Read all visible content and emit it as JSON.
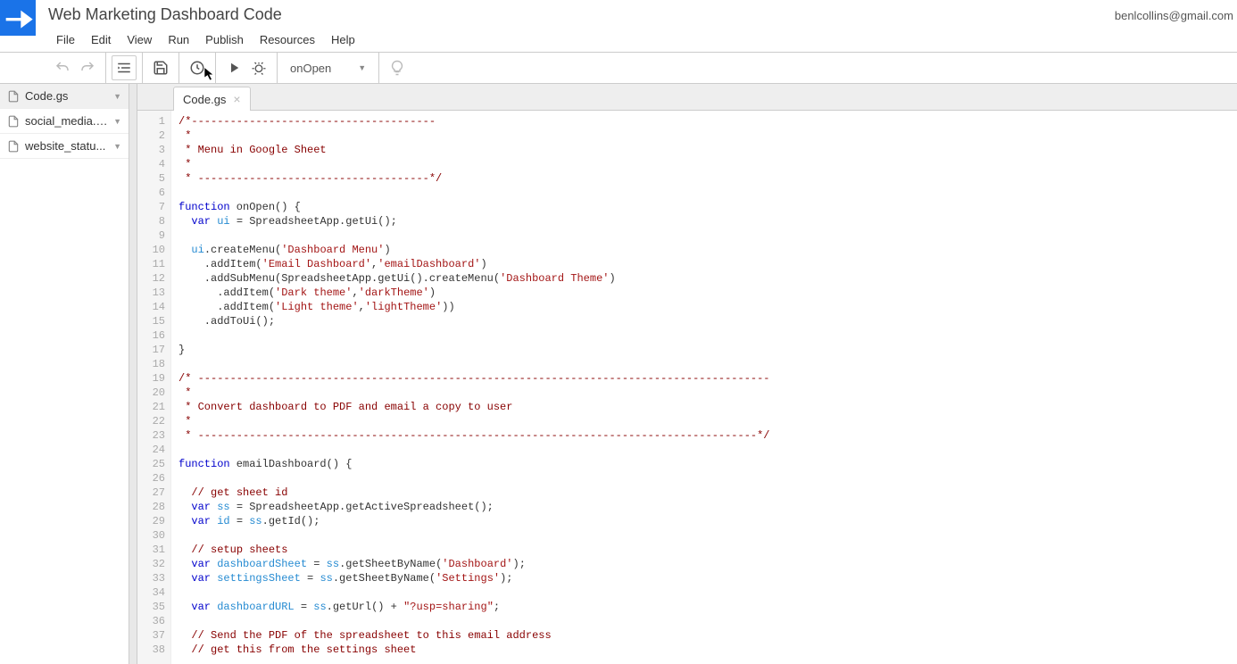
{
  "doc_title": "Web Marketing Dashboard Code",
  "user_email": "benlcollins@gmail.com",
  "menus": [
    "File",
    "Edit",
    "View",
    "Run",
    "Publish",
    "Resources",
    "Help"
  ],
  "selected_function": "onOpen",
  "sidebar_files": [
    {
      "name": "Code.gs",
      "active": true
    },
    {
      "name": "social_media.gs",
      "active": false
    },
    {
      "name": "website_statu...",
      "active": false
    }
  ],
  "active_tab": "Code.gs",
  "code_lines": [
    {
      "n": 1,
      "segs": [
        {
          "t": "/*--------------------------------------",
          "c": "c-cmt"
        }
      ]
    },
    {
      "n": 2,
      "segs": [
        {
          "t": " *",
          "c": "c-cmt"
        }
      ]
    },
    {
      "n": 3,
      "segs": [
        {
          "t": " * Menu in Google Sheet",
          "c": "c-cmt"
        }
      ]
    },
    {
      "n": 4,
      "segs": [
        {
          "t": " *",
          "c": "c-cmt"
        }
      ]
    },
    {
      "n": 5,
      "segs": [
        {
          "t": " * ------------------------------------*/",
          "c": "c-cmt"
        }
      ]
    },
    {
      "n": 6,
      "segs": []
    },
    {
      "n": 7,
      "segs": [
        {
          "t": "function",
          "c": "c-kw"
        },
        {
          "t": " onOpen() {",
          "c": ""
        }
      ]
    },
    {
      "n": 8,
      "segs": [
        {
          "t": "  ",
          "c": ""
        },
        {
          "t": "var",
          "c": "c-kw"
        },
        {
          "t": " ",
          "c": ""
        },
        {
          "t": "ui",
          "c": "c-var"
        },
        {
          "t": " = SpreadsheetApp.getUi();",
          "c": ""
        }
      ]
    },
    {
      "n": 9,
      "segs": []
    },
    {
      "n": 10,
      "segs": [
        {
          "t": "  ",
          "c": ""
        },
        {
          "t": "ui",
          "c": "c-var"
        },
        {
          "t": ".createMenu(",
          "c": ""
        },
        {
          "t": "'Dashboard Menu'",
          "c": "c-str"
        },
        {
          "t": ")",
          "c": ""
        }
      ]
    },
    {
      "n": 11,
      "segs": [
        {
          "t": "    .addItem(",
          "c": ""
        },
        {
          "t": "'Email Dashboard'",
          "c": "c-str"
        },
        {
          "t": ",",
          "c": ""
        },
        {
          "t": "'emailDashboard'",
          "c": "c-str"
        },
        {
          "t": ")",
          "c": ""
        }
      ]
    },
    {
      "n": 12,
      "segs": [
        {
          "t": "    .addSubMenu(SpreadsheetApp.getUi().createMenu(",
          "c": ""
        },
        {
          "t": "'Dashboard Theme'",
          "c": "c-str"
        },
        {
          "t": ")",
          "c": ""
        }
      ]
    },
    {
      "n": 13,
      "segs": [
        {
          "t": "      .addItem(",
          "c": ""
        },
        {
          "t": "'Dark theme'",
          "c": "c-str"
        },
        {
          "t": ",",
          "c": ""
        },
        {
          "t": "'darkTheme'",
          "c": "c-str"
        },
        {
          "t": ")",
          "c": ""
        }
      ]
    },
    {
      "n": 14,
      "segs": [
        {
          "t": "      .addItem(",
          "c": ""
        },
        {
          "t": "'Light theme'",
          "c": "c-str"
        },
        {
          "t": ",",
          "c": ""
        },
        {
          "t": "'lightTheme'",
          "c": "c-str"
        },
        {
          "t": "))",
          "c": ""
        }
      ]
    },
    {
      "n": 15,
      "segs": [
        {
          "t": "    .addToUi();",
          "c": ""
        }
      ]
    },
    {
      "n": 16,
      "segs": []
    },
    {
      "n": 17,
      "segs": [
        {
          "t": "}",
          "c": ""
        }
      ]
    },
    {
      "n": 18,
      "segs": []
    },
    {
      "n": 19,
      "segs": [
        {
          "t": "/* -----------------------------------------------------------------------------------------",
          "c": "c-cmt"
        }
      ]
    },
    {
      "n": 20,
      "segs": [
        {
          "t": " *",
          "c": "c-cmt"
        }
      ]
    },
    {
      "n": 21,
      "segs": [
        {
          "t": " * Convert dashboard to PDF and email a copy to user",
          "c": "c-cmt"
        }
      ]
    },
    {
      "n": 22,
      "segs": [
        {
          "t": " *",
          "c": "c-cmt"
        }
      ]
    },
    {
      "n": 23,
      "segs": [
        {
          "t": " * ---------------------------------------------------------------------------------------*/",
          "c": "c-cmt"
        }
      ]
    },
    {
      "n": 24,
      "segs": []
    },
    {
      "n": 25,
      "segs": [
        {
          "t": "function",
          "c": "c-kw"
        },
        {
          "t": " emailDashboard() {",
          "c": ""
        }
      ]
    },
    {
      "n": 26,
      "segs": []
    },
    {
      "n": 27,
      "segs": [
        {
          "t": "  ",
          "c": ""
        },
        {
          "t": "// get sheet id",
          "c": "c-cmt"
        }
      ]
    },
    {
      "n": 28,
      "segs": [
        {
          "t": "  ",
          "c": ""
        },
        {
          "t": "var",
          "c": "c-kw"
        },
        {
          "t": " ",
          "c": ""
        },
        {
          "t": "ss",
          "c": "c-var"
        },
        {
          "t": " = SpreadsheetApp.getActiveSpreadsheet();",
          "c": ""
        }
      ]
    },
    {
      "n": 29,
      "segs": [
        {
          "t": "  ",
          "c": ""
        },
        {
          "t": "var",
          "c": "c-kw"
        },
        {
          "t": " ",
          "c": ""
        },
        {
          "t": "id",
          "c": "c-var"
        },
        {
          "t": " = ",
          "c": ""
        },
        {
          "t": "ss",
          "c": "c-var"
        },
        {
          "t": ".getId();",
          "c": ""
        }
      ]
    },
    {
      "n": 30,
      "segs": []
    },
    {
      "n": 31,
      "segs": [
        {
          "t": "  ",
          "c": ""
        },
        {
          "t": "// setup sheets",
          "c": "c-cmt"
        }
      ]
    },
    {
      "n": 32,
      "segs": [
        {
          "t": "  ",
          "c": ""
        },
        {
          "t": "var",
          "c": "c-kw"
        },
        {
          "t": " ",
          "c": ""
        },
        {
          "t": "dashboardSheet",
          "c": "c-var"
        },
        {
          "t": " = ",
          "c": ""
        },
        {
          "t": "ss",
          "c": "c-var"
        },
        {
          "t": ".getSheetByName(",
          "c": ""
        },
        {
          "t": "'Dashboard'",
          "c": "c-str"
        },
        {
          "t": ");",
          "c": ""
        }
      ]
    },
    {
      "n": 33,
      "segs": [
        {
          "t": "  ",
          "c": ""
        },
        {
          "t": "var",
          "c": "c-kw"
        },
        {
          "t": " ",
          "c": ""
        },
        {
          "t": "settingsSheet",
          "c": "c-var"
        },
        {
          "t": " = ",
          "c": ""
        },
        {
          "t": "ss",
          "c": "c-var"
        },
        {
          "t": ".getSheetByName(",
          "c": ""
        },
        {
          "t": "'Settings'",
          "c": "c-str"
        },
        {
          "t": ");",
          "c": ""
        }
      ]
    },
    {
      "n": 34,
      "segs": []
    },
    {
      "n": 35,
      "segs": [
        {
          "t": "  ",
          "c": ""
        },
        {
          "t": "var",
          "c": "c-kw"
        },
        {
          "t": " ",
          "c": ""
        },
        {
          "t": "dashboardURL",
          "c": "c-var"
        },
        {
          "t": " = ",
          "c": ""
        },
        {
          "t": "ss",
          "c": "c-var"
        },
        {
          "t": ".getUrl() + ",
          "c": ""
        },
        {
          "t": "\"?usp=sharing\"",
          "c": "c-str"
        },
        {
          "t": ";",
          "c": ""
        }
      ]
    },
    {
      "n": 36,
      "segs": []
    },
    {
      "n": 37,
      "segs": [
        {
          "t": "  ",
          "c": ""
        },
        {
          "t": "// Send the PDF of the spreadsheet to this email address",
          "c": "c-cmt"
        }
      ]
    },
    {
      "n": 38,
      "segs": [
        {
          "t": "  ",
          "c": ""
        },
        {
          "t": "// get this from the settings sheet",
          "c": "c-cmt"
        }
      ]
    }
  ]
}
